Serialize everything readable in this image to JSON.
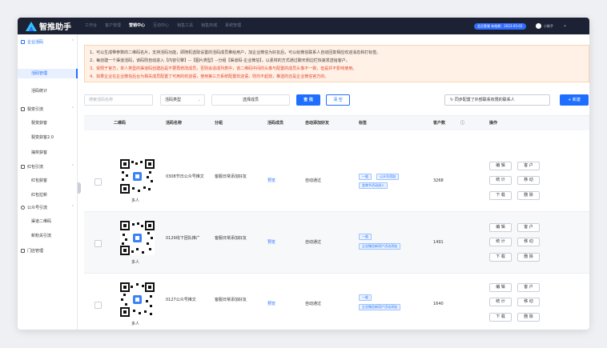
{
  "app": {
    "logo": "智推助手",
    "expiry": "会员套餐 有效期：2023-05-02",
    "username": "小助手"
  },
  "topnav": [
    "工作台",
    "客户管理",
    "营销中心",
    "互动中心",
    "销售工具",
    "销售商城",
    "系统管理"
  ],
  "sidebar": {
    "sections": [
      {
        "label": "企业活码",
        "items": [
          "活码管理",
          "活码统计"
        ]
      },
      {
        "label": "裂变引流",
        "items": [
          "裂变获客",
          "裂变获客2.0",
          "抽奖获客"
        ]
      },
      {
        "label": "红包引流",
        "items": [
          "红包获客",
          "红包拉新"
        ]
      },
      {
        "label": "公众号引流",
        "items": [
          "渠道二维码",
          "新粉关引流"
        ]
      },
      {
        "label": "门店管理",
        "items": []
      }
    ]
  },
  "notice": [
    "1、可以生成带参数的二维码名片，支持活码功能，即随机选取设置的活码成员推给用户，加企业微信为好友后，可以给微信联系人自动回复相应欢迎消息和打标签。",
    "2、每创建一个渠道活码，该码则自动进入【内容引擎】--【图片类型】--分组【渠道码-企业微信】，以素材的方式通过聊天侧边栏快速发送给客户。",
    "3、受限于官方，单人类型的渠道码创建后是不要再修改成员，否则会造成列表中，该二维码中间的头像与配置的成员头像不一致，但是并不影响使用。",
    "4、如果企业在企业微信后台为相关成员配置了可用的欢迎语，使用第三方系统配置欢迎语，则均不起效，推送的还是企业微信官方的。"
  ],
  "toolbar": {
    "search_placeholder": "搜索活码名称",
    "type_placeholder": "活码类型",
    "member_placeholder": "选择成员",
    "search_btn": "查 找",
    "clear_btn": "清 空",
    "sync_btn": "同步配置了外部联系权限的联系人",
    "new_btn": "+ 新建"
  },
  "table": {
    "headers": [
      "二维码",
      "活码名称",
      "分组",
      "活码成员",
      "自动添加好友",
      "标签",
      "客户数",
      "操作"
    ],
    "ops": [
      "编 辑",
      "客 户",
      "统 计",
      "移 动",
      "下 载",
      "删 除"
    ],
    "rows": [
      {
        "qr_caption": "多人",
        "name": "0308节日公众号推文",
        "group": "客服日常添加好友",
        "member": "预览",
        "auto": "自动通过",
        "tags": [
          "一般",
          "公众号添加",
          "女神节活动进入"
        ],
        "count": "3268"
      },
      {
        "qr_caption": "多人",
        "name": "0129线下团队推广",
        "group": "客服日常添加好友",
        "member": "预览",
        "auto": "自动通过",
        "tags": [
          "一般",
          "企业微信新用户活动添加"
        ],
        "count": "1491"
      },
      {
        "qr_caption": "多人",
        "name": "0127公众号推文",
        "group": "客服日常添加好友",
        "member": "预览",
        "auto": "自动通过",
        "tags": [
          "一般",
          "企业微信新用户活动添加"
        ],
        "count": "1640"
      }
    ]
  }
}
